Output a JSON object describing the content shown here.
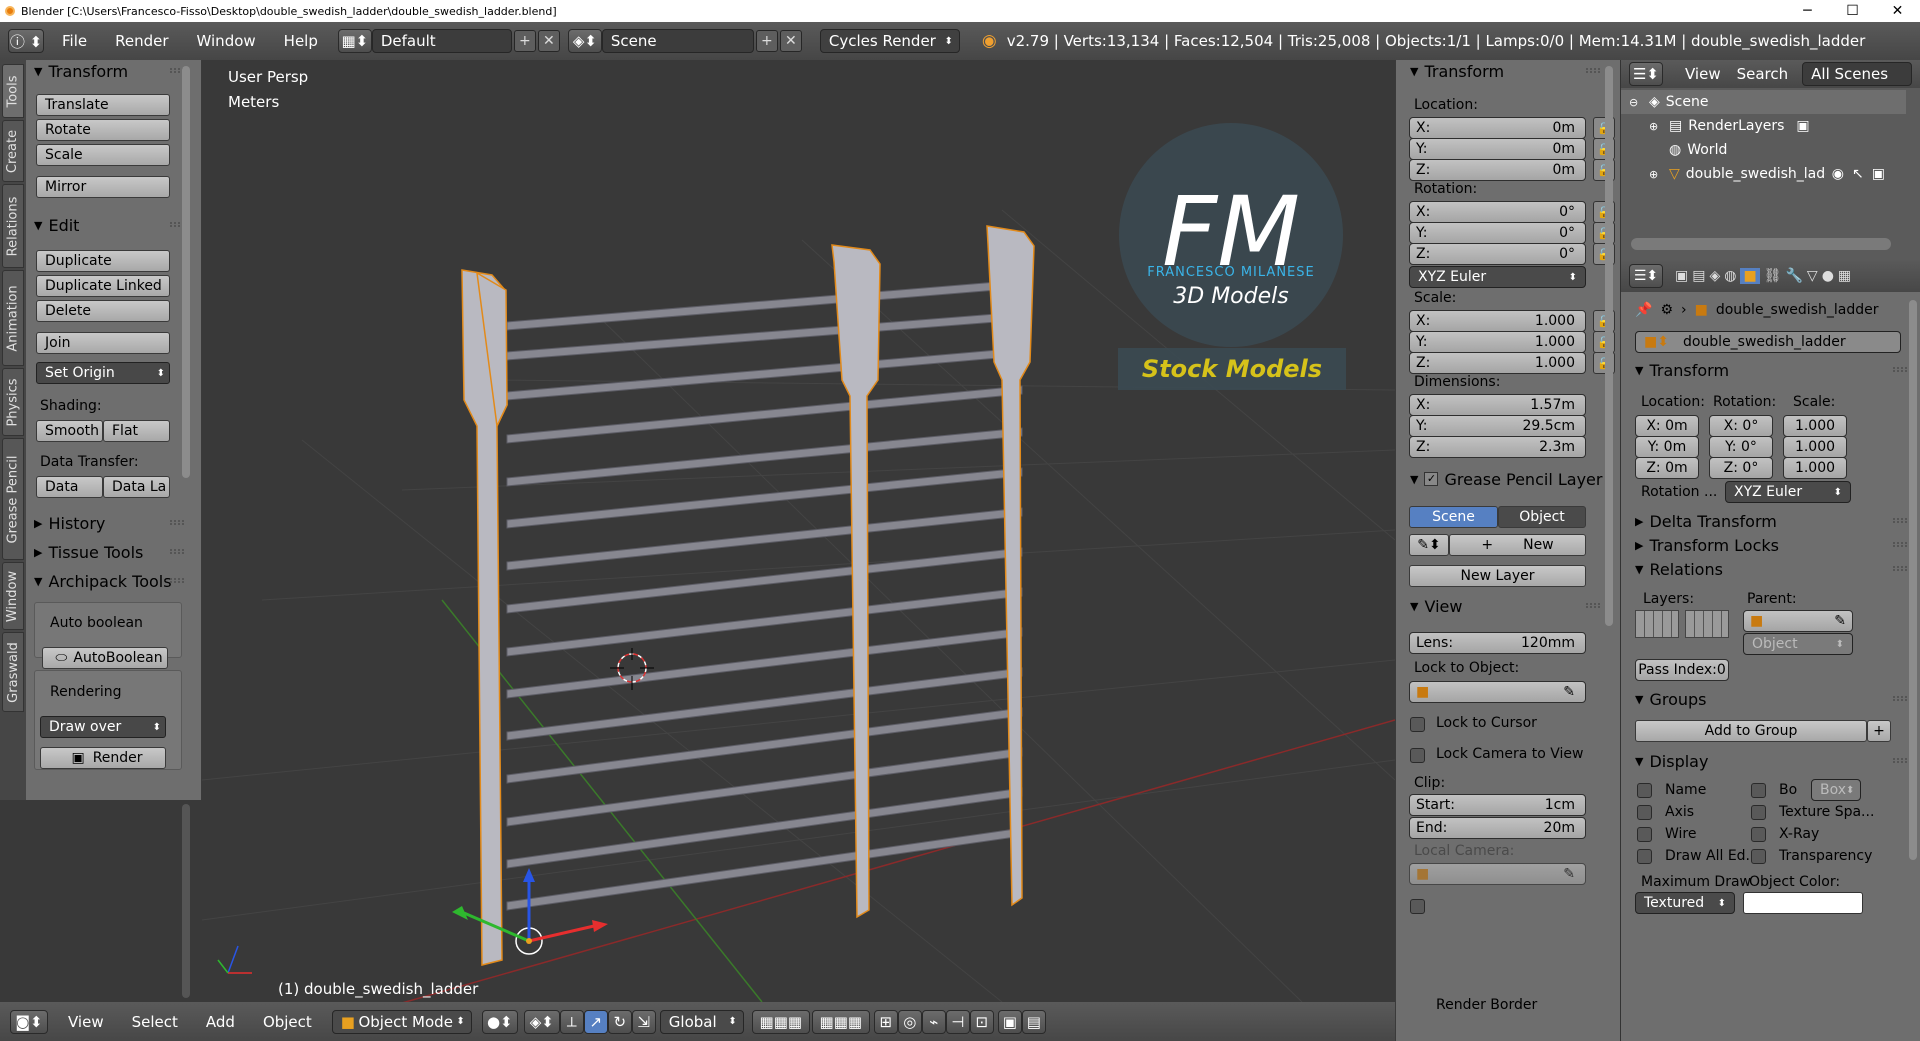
{
  "window": {
    "title": "Blender [C:\\Users\\Francesco-Fisso\\Desktop\\double_swedish_ladder\\double_swedish_ladder.blend]",
    "min": "─",
    "max": "☐",
    "close": "✕"
  },
  "topbar": {
    "menus": [
      "File",
      "Render",
      "Window",
      "Help"
    ],
    "layout": "Default",
    "scene": "Scene",
    "engine": "Cycles Render",
    "stats": "v2.79 | Verts:13,134 | Faces:12,504 | Tris:25,008 | Objects:1/1 | Lamps:0/0 | Mem:14.31M | double_swedish_ladder"
  },
  "left_tabs": [
    "Tools",
    "Create",
    "Relations",
    "Animation",
    "Physics",
    "Grease Pencil",
    "Window",
    "Graswald"
  ],
  "toolshelf": {
    "transform_header": "Transform",
    "translate": "Translate",
    "rotate": "Rotate",
    "scale": "Scale",
    "mirror": "Mirror",
    "edit_header": "Edit",
    "duplicate": "Duplicate",
    "duplicate_linked": "Duplicate Linked",
    "delete": "Delete",
    "join": "Join",
    "set_origin": "Set Origin",
    "shading_label": "Shading:",
    "smooth": "Smooth",
    "flat": "Flat",
    "data_transfer_label": "Data Transfer:",
    "data": "Data",
    "data_la": "Data La",
    "history": "History",
    "tissue": "Tissue Tools",
    "archipack": "Archipack Tools",
    "auto_boolean_label": "Auto boolean",
    "auto_boolean_btn": "AutoBoolean",
    "rendering_label": "Rendering",
    "draw_over": "Draw over",
    "render": "Render"
  },
  "viewport": {
    "view_name": "User Persp",
    "units": "Meters",
    "object_label": "(1) double_swedish_ladder",
    "logo_letters": "FM",
    "logo_name": "FRANCESCO MILANESE",
    "logo_sub": "3D Models",
    "stock": "Stock Models"
  },
  "bottombar": {
    "view": "View",
    "select": "Select",
    "add": "Add",
    "object": "Object",
    "mode": "Object Mode",
    "orientation": "Global"
  },
  "npanel": {
    "transform": "Transform",
    "location": "Location:",
    "loc": [
      {
        "axis": "X:",
        "val": "0m"
      },
      {
        "axis": "Y:",
        "val": "0m"
      },
      {
        "axis": "Z:",
        "val": "0m"
      }
    ],
    "rotation": "Rotation:",
    "rot": [
      {
        "axis": "X:",
        "val": "0°"
      },
      {
        "axis": "Y:",
        "val": "0°"
      },
      {
        "axis": "Z:",
        "val": "0°"
      }
    ],
    "rot_mode": "XYZ Euler",
    "scale": "Scale:",
    "scl": [
      {
        "axis": "X:",
        "val": "1.000"
      },
      {
        "axis": "Y:",
        "val": "1.000"
      },
      {
        "axis": "Z:",
        "val": "1.000"
      }
    ],
    "dimensions": "Dimensions:",
    "dim": [
      {
        "axis": "X:",
        "val": "1.57m"
      },
      {
        "axis": "Y:",
        "val": "29.5cm"
      },
      {
        "axis": "Z:",
        "val": "2.3m"
      }
    ],
    "grease_pencil": "Grease Pencil Layer",
    "scene_btn": "Scene",
    "object_btn": "Object",
    "new_btn": "New",
    "new_layer": "New Layer",
    "view": "View",
    "lens_label": "Lens:",
    "lens_val": "120mm",
    "lock_to_object": "Lock to Object:",
    "lock_to_cursor": "Lock to Cursor",
    "lock_camera": "Lock Camera to View",
    "clip": "Clip:",
    "clip_start_label": "Start:",
    "clip_start": "1cm",
    "clip_end_label": "End:",
    "clip_end": "20m",
    "local_camera": "Local Camera:",
    "render_border": "Render Border"
  },
  "outliner": {
    "view": "View",
    "search": "Search",
    "all_scenes": "All Scenes",
    "items": [
      "Scene",
      "RenderLayers",
      "World",
      "double_swedish_ladder"
    ]
  },
  "props": {
    "object_name_path": "double_swedish_ladder",
    "object_name": "double_swedish_ladder",
    "transform": "Transform",
    "location": "Location:",
    "rotation": "Rotation:",
    "scale": "Scale:",
    "loc": [
      "X: 0m",
      "Y: 0m",
      "Z: 0m"
    ],
    "rot": [
      "X:   0°",
      "Y:   0°",
      "Z:   0°"
    ],
    "scl": [
      "1.000",
      "1.000",
      "1.000"
    ],
    "rotation_mode_label": "Rotation ...",
    "rotation_mode": "XYZ Euler",
    "delta": "Delta Transform",
    "locks": "Transform Locks",
    "relations": "Relations",
    "layers": "Layers:",
    "parent": "Parent:",
    "parent_type": "Object",
    "pass_index": "Pass Index:0",
    "groups": "Groups",
    "add_to_group": "Add to Group",
    "display": "Display",
    "name": "Name",
    "bo": "Bo",
    "box": "Box",
    "axis": "Axis",
    "texture_space": "Texture Spa...",
    "wire": "Wire",
    "xray": "X-Ray",
    "draw_all": "Draw All Ed...",
    "transparency": "Transparency",
    "max_draw": "Maximum Draw",
    "object_color": "Object Color:",
    "textured": "Textured"
  },
  "colors": {
    "accent": "#5680c2",
    "header": "#4a4a4a",
    "panel": "#6e6e6e",
    "viewport": "#393939",
    "logo_blue": "#3ab4e8",
    "stock_yellow": "#d6c21a"
  }
}
